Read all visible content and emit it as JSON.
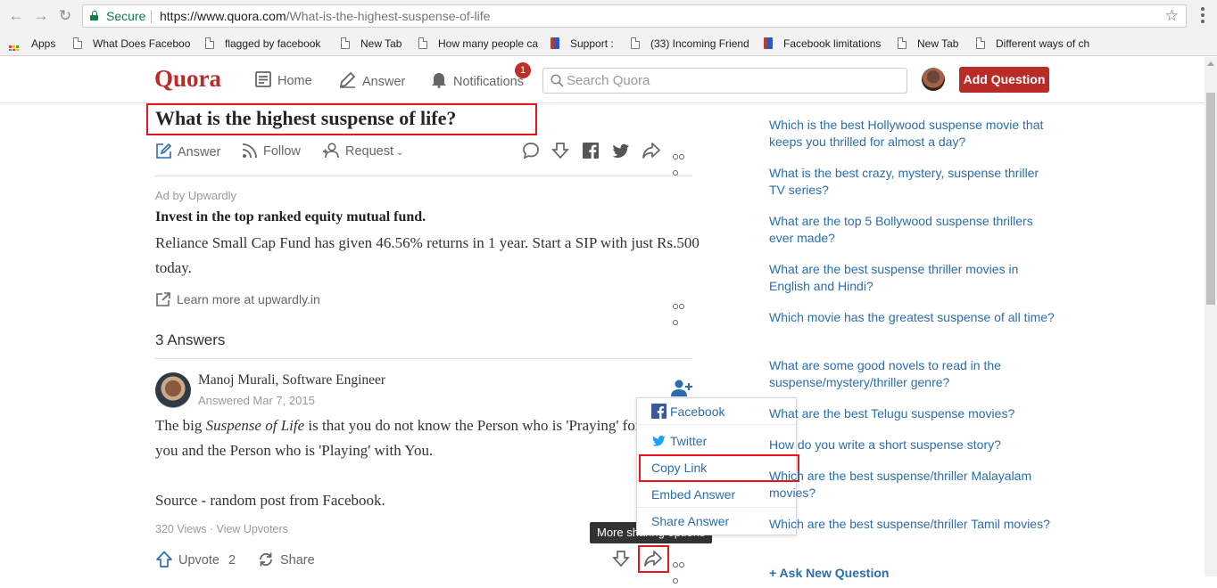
{
  "browser": {
    "secure_label": "Secure",
    "url_host": "https://www.quora.com",
    "url_path": "/What-is-the-highest-suspense-of-life",
    "bookmarks": [
      {
        "label": "Apps",
        "icon": "apps-grid-icon"
      },
      {
        "label": "What Does Faceboo",
        "icon": "page-icon"
      },
      {
        "label": "flagged by facebook",
        "icon": "page-icon"
      },
      {
        "label": "New Tab",
        "icon": "page-icon"
      },
      {
        "label": "How many people ca",
        "icon": "page-icon"
      },
      {
        "label": "Support :",
        "icon": "dw-icon"
      },
      {
        "label": "(33) Incoming Friend",
        "icon": "page-icon"
      },
      {
        "label": "Facebook limitations",
        "icon": "dw-icon"
      },
      {
        "label": "New Tab",
        "icon": "page-icon"
      },
      {
        "label": "Different ways of ch",
        "icon": "page-icon"
      }
    ]
  },
  "header": {
    "logo": "Quora",
    "nav": {
      "home": "Home",
      "answer": "Answer",
      "notifications": "Notifications"
    },
    "notification_count": "1",
    "search_placeholder": "Search Quora",
    "add_question": "Add Question"
  },
  "question": {
    "title": "What is the highest suspense of life?",
    "actions": {
      "answer": "Answer",
      "follow": "Follow",
      "request": "Request"
    }
  },
  "ad": {
    "by": "Ad by Upwardly",
    "title": "Invest in the top ranked equity mutual fund.",
    "text": "Reliance Small Cap Fund has given 46.56% returns in 1 year. Start a SIP with just Rs.500 today.",
    "link": "Learn more at upwardly.in"
  },
  "answers": {
    "count_label": "3 Answers",
    "first": {
      "author": "Manoj Murali, Software Engineer",
      "date": "Answered Mar 7, 2015",
      "body_pre": "The big ",
      "body_em": "Suspense of Life",
      "body_post": " is that you do not know the Person who is 'Praying' for",
      "body_line2": "you and the Person who is 'Playing' with You.",
      "body_line3": "Source - random post from Facebook.",
      "views": "320 Views · View Upvoters",
      "upvote_label": "Upvote",
      "upvote_count": "2",
      "share_label": "Share"
    }
  },
  "tooltip": "More sharing options",
  "share_menu": [
    "Facebook",
    "Twitter",
    "Copy Link",
    "Embed Answer",
    "Share Answer"
  ],
  "related": [
    "Which is the best Hollywood suspense movie that keeps you thrilled for almost a day?",
    "What is the best crazy, mystery, suspense thriller TV series?",
    "What are the top 5 Bollywood suspense thrillers ever made?",
    "What are the best suspense thriller movies in English and Hindi?",
    "Which movie has the greatest suspense of all time?",
    "What are some good novels to read in the suspense/mystery/thriller genre?",
    "What are the best Telugu suspense movies?",
    "How do you write a short suspense story?",
    "Which are the best suspense/thriller Malayalam movies?",
    "Which are the best suspense/thriller Tamil movies?"
  ],
  "ask_new": "+ Ask New Question",
  "colors": {
    "brand": "#b92b27",
    "link": "#2b6dad",
    "highlight": "#e4151c",
    "secure": "#0b8043"
  }
}
